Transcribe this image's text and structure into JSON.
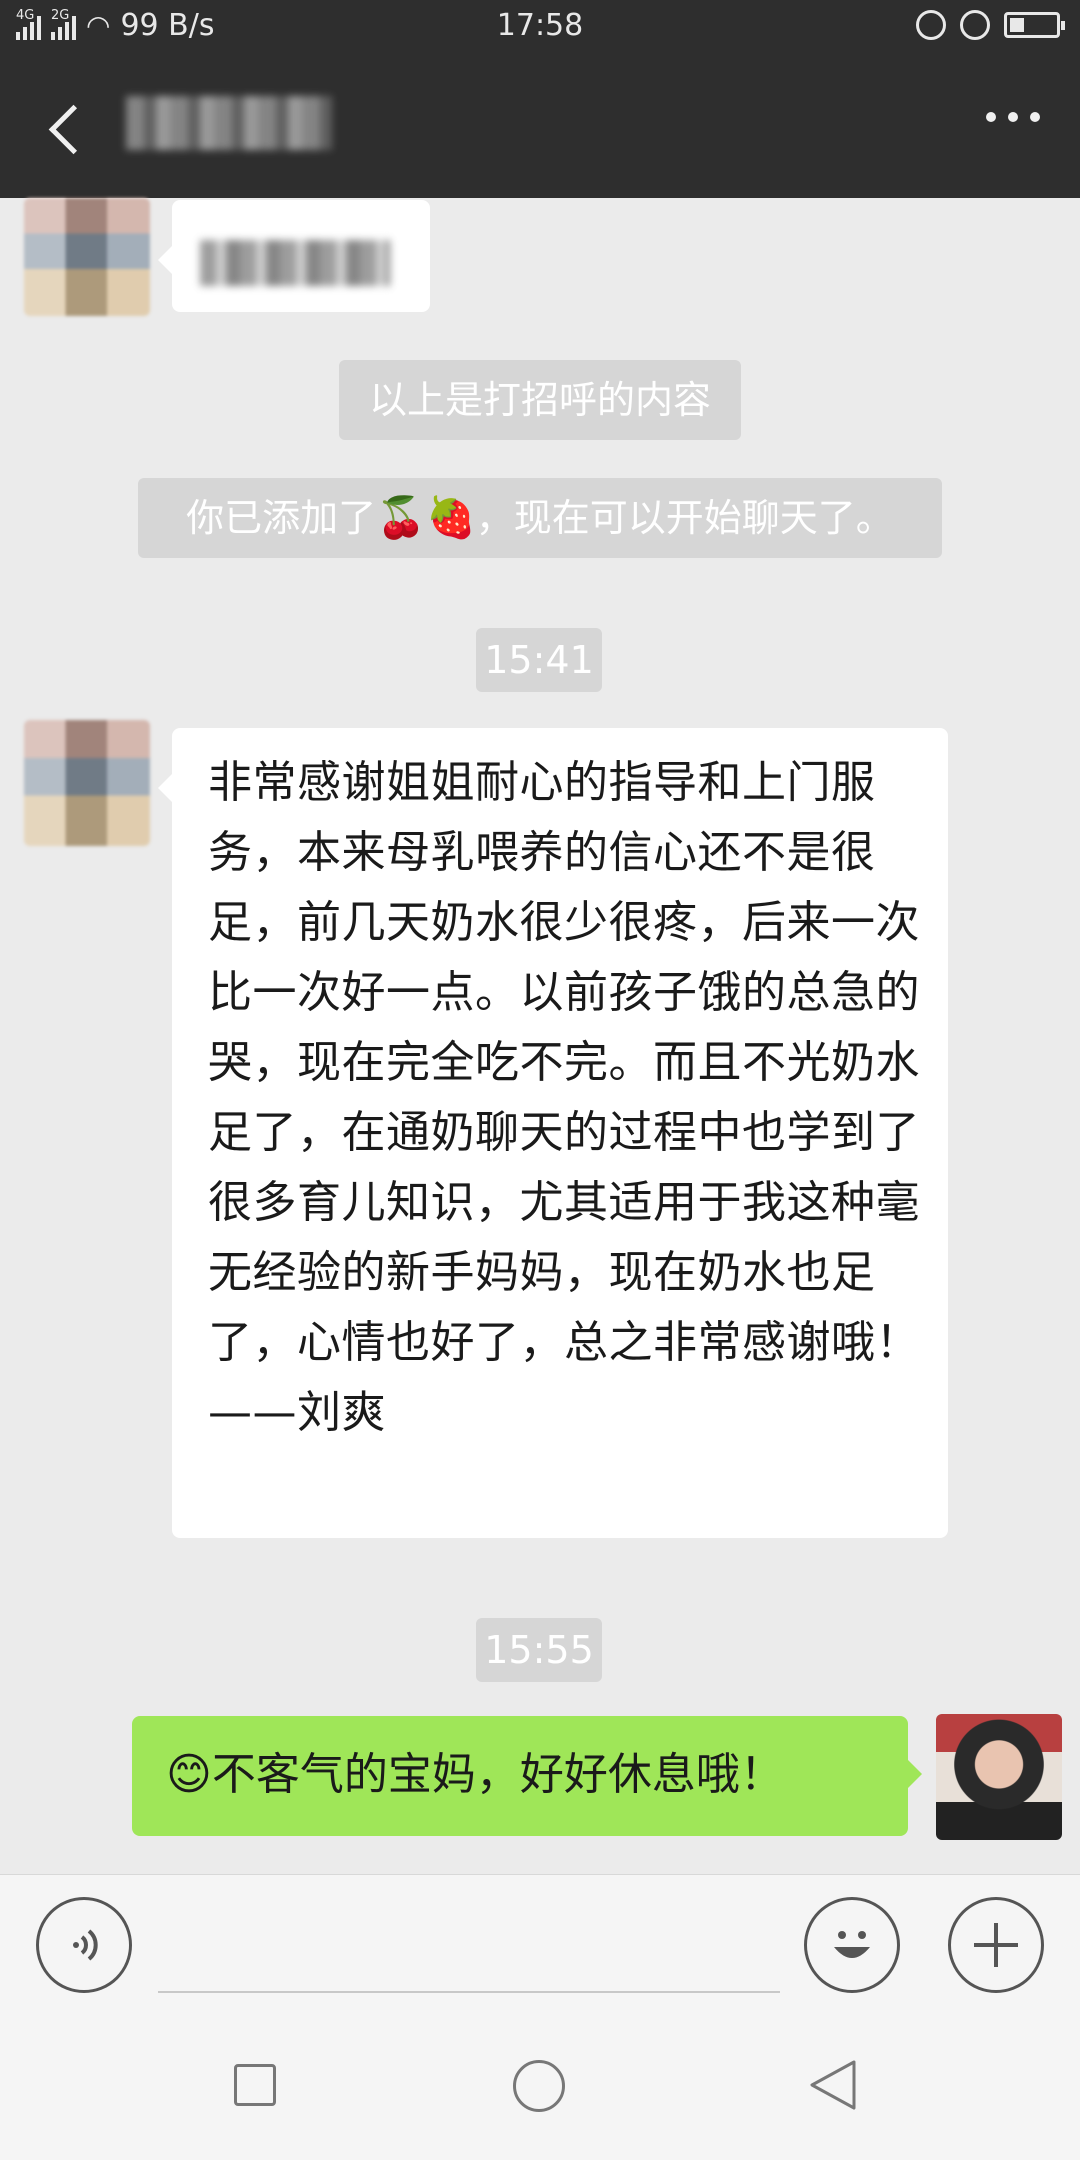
{
  "status_bar": {
    "net_speed": "99 B/s",
    "time": "17:58",
    "signal_labels": [
      "4G",
      "2G"
    ]
  },
  "header": {
    "back_icon": "chevron-left-icon",
    "more_icon": "more-dots-icon"
  },
  "messages": {
    "system_greeting": "以上是打招呼的内容",
    "system_added_prefix": "你已添加了",
    "system_added_emojis": "🍒🍓",
    "system_added_suffix": "，现在可以开始聊天了。",
    "time1": "15:41",
    "long_message": "非常感谢姐姐耐心的指导和上门服务，本来母乳喂养的信心还不是很足，前几天奶水很少很疼，后来一次比一次好一点。以前孩子饿的总急的哭，现在完全吃不完。而且不光奶水足了，在通奶聊天的过程中也学到了很多育儿知识，尤其适用于我这种毫无经验的新手妈妈，现在奶水也足了，心情也好了，总之非常感谢哦！            ——刘爽",
    "time2": "15:55",
    "reply_emoji": "😊",
    "reply_text": "不客气的宝妈，好好休息哦！"
  },
  "input_bar": {
    "voice_icon": "voice-icon",
    "emoji_icon": "emoji-icon",
    "plus_icon": "plus-icon"
  },
  "colors": {
    "header_bg": "#2e2e2e",
    "chat_bg": "#ebebeb",
    "incoming_bubble": "#ffffff",
    "outgoing_bubble": "#9fe658",
    "system_bubble": "#d6d6d6"
  }
}
